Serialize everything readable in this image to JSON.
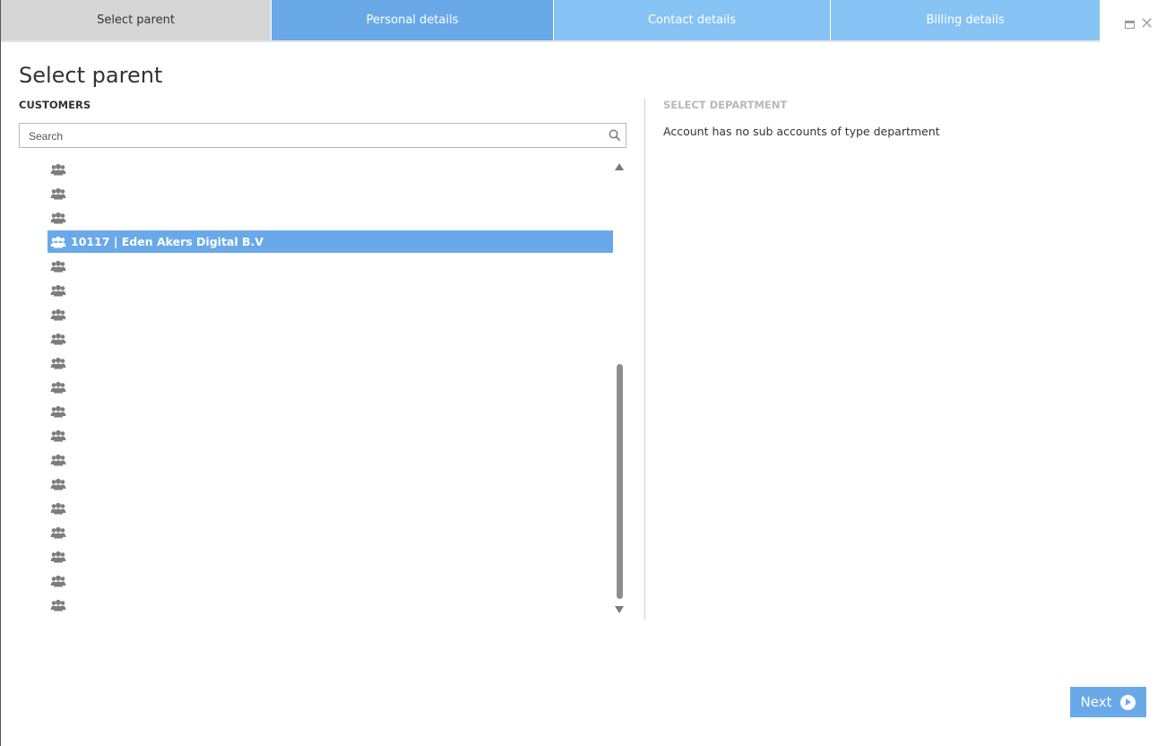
{
  "tabs": [
    {
      "label": "Select parent",
      "state": "active"
    },
    {
      "label": "Personal details",
      "state": "next"
    },
    {
      "label": "Contact details",
      "state": "upcoming"
    },
    {
      "label": "Billing details",
      "state": "upcoming"
    }
  ],
  "page": {
    "title": "Select parent"
  },
  "customers": {
    "label": "CUSTOMERS",
    "search_placeholder": "Search",
    "rows": [
      {
        "label": "",
        "selected": false
      },
      {
        "label": "",
        "selected": false
      },
      {
        "label": "",
        "selected": false
      },
      {
        "label": "10117 | Eden Akers Digital B.V",
        "selected": true
      },
      {
        "label": "",
        "selected": false
      },
      {
        "label": "",
        "selected": false
      },
      {
        "label": "",
        "selected": false
      },
      {
        "label": "",
        "selected": false
      },
      {
        "label": "",
        "selected": false
      },
      {
        "label": "",
        "selected": false
      },
      {
        "label": "",
        "selected": false
      },
      {
        "label": "",
        "selected": false
      },
      {
        "label": "",
        "selected": false
      },
      {
        "label": "",
        "selected": false
      },
      {
        "label": "",
        "selected": false
      },
      {
        "label": "",
        "selected": false
      },
      {
        "label": "",
        "selected": false
      },
      {
        "label": "",
        "selected": false
      },
      {
        "label": "",
        "selected": false
      }
    ]
  },
  "department": {
    "label": "SELECT DEPARTMENT",
    "message": "Account has no sub accounts of type department"
  },
  "footer": {
    "next_label": "Next"
  },
  "colors": {
    "accent": "#6aa9e8",
    "tab_light": "#87c3f5",
    "tab_active": "#d6d6d6",
    "icon_gray": "#7d7d7d"
  },
  "icons": {
    "customer_row": "users-group-icon",
    "search": "search-icon",
    "next": "arrow-circle-right-icon"
  }
}
